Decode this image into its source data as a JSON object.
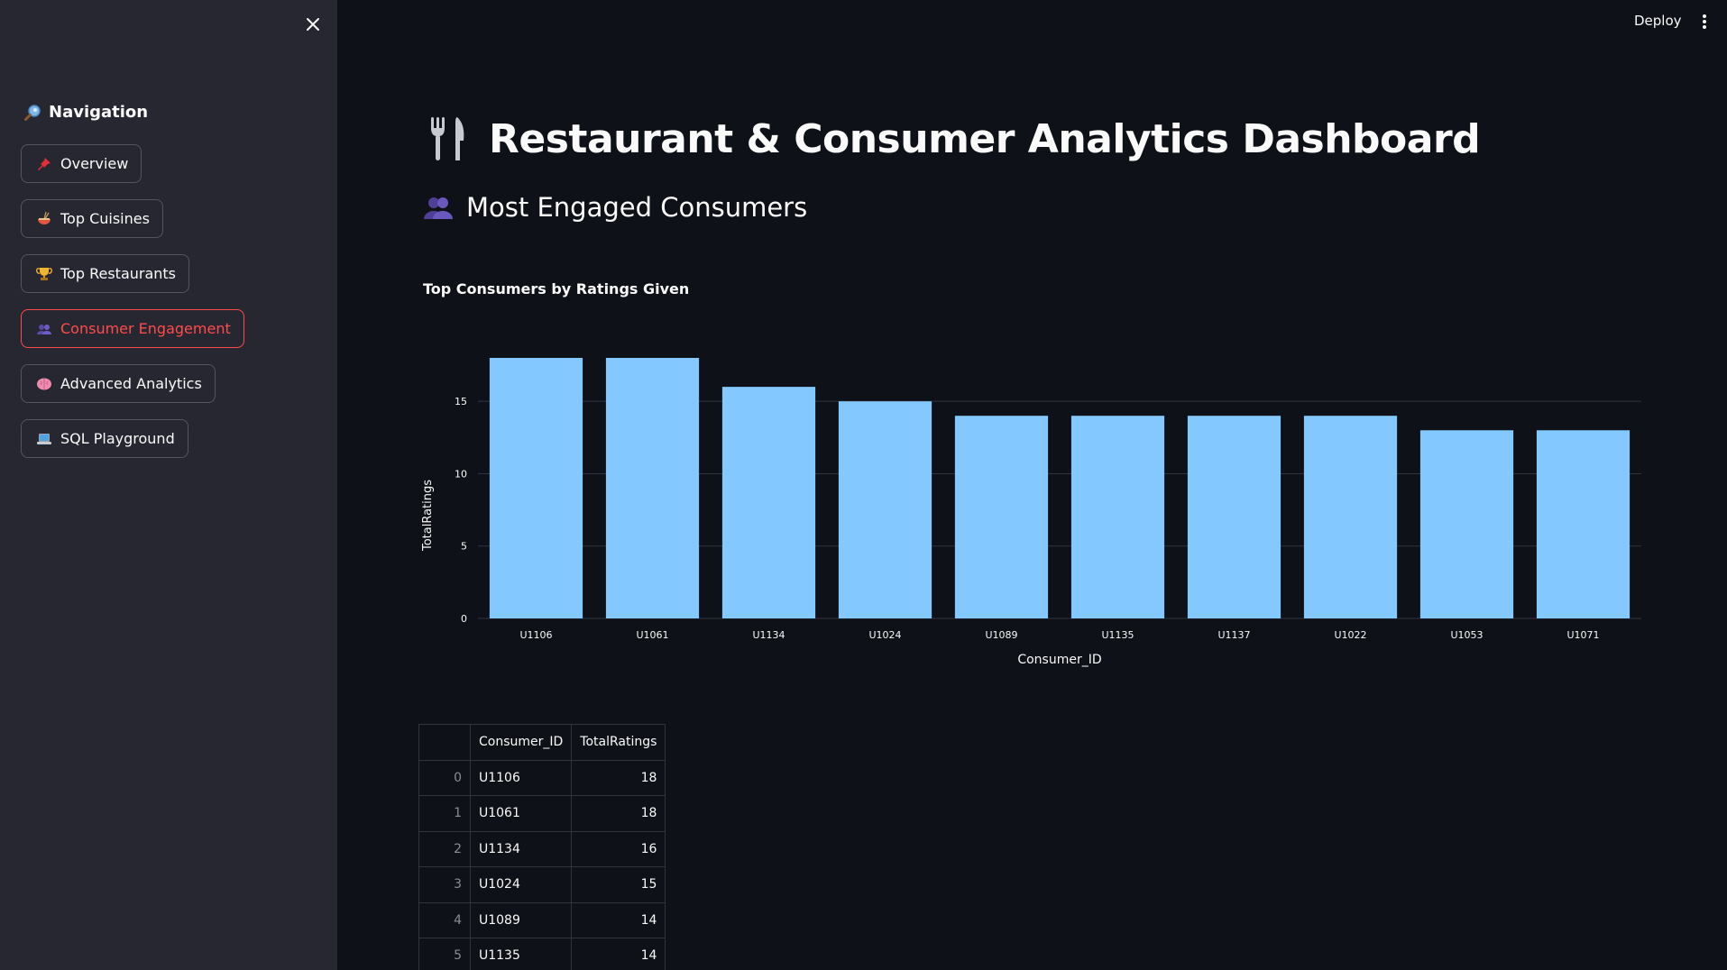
{
  "sidebar": {
    "title": "Navigation",
    "items": [
      {
        "label": "Overview",
        "icon": "pushpin-icon"
      },
      {
        "label": "Top Cuisines",
        "icon": "noodle-bowl-icon"
      },
      {
        "label": "Top Restaurants",
        "icon": "trophy-icon"
      },
      {
        "label": "Consumer Engagement",
        "icon": "users-icon",
        "active": true
      },
      {
        "label": "Advanced Analytics",
        "icon": "brain-icon"
      },
      {
        "label": "SQL Playground",
        "icon": "laptop-icon"
      }
    ]
  },
  "header": {
    "deploy_label": "Deploy"
  },
  "main": {
    "title": "Restaurant & Consumer Analytics Dashboard",
    "subtitle": "Most Engaged Consumers"
  },
  "colors": {
    "accent": "#ff4b4b",
    "bar": "#83c9ff",
    "sidebar_bg": "#262730",
    "main_bg": "#0e1117"
  },
  "chart_data": {
    "type": "bar",
    "title": "Top Consumers by Ratings Given",
    "xlabel": "Consumer_ID",
    "ylabel": "TotalRatings",
    "categories": [
      "U1106",
      "U1061",
      "U1134",
      "U1024",
      "U1089",
      "U1135",
      "U1137",
      "U1022",
      "U1053",
      "U1071"
    ],
    "values": [
      18,
      18,
      16,
      15,
      14,
      14,
      14,
      14,
      13,
      13
    ],
    "ylim": [
      0,
      18
    ],
    "yticks": [
      0,
      5,
      10,
      15
    ],
    "grid": true
  },
  "table": {
    "columns": [
      "Consumer_ID",
      "TotalRatings"
    ],
    "rows": [
      {
        "index": "0",
        "id": "U1106",
        "value": "18"
      },
      {
        "index": "1",
        "id": "U1061",
        "value": "18"
      },
      {
        "index": "2",
        "id": "U1134",
        "value": "16"
      },
      {
        "index": "3",
        "id": "U1024",
        "value": "15"
      },
      {
        "index": "4",
        "id": "U1089",
        "value": "14"
      },
      {
        "index": "5",
        "id": "U1135",
        "value": "14"
      }
    ]
  }
}
